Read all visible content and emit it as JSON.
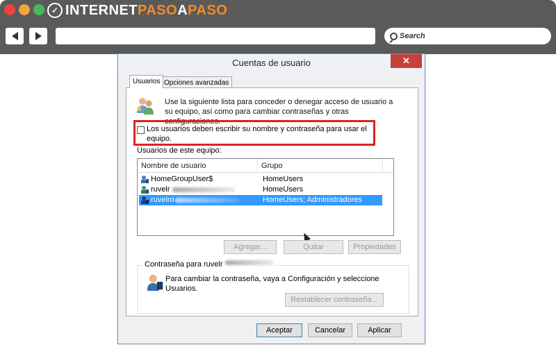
{
  "browser": {
    "logo_part1": "INTERNET",
    "logo_part2": "PASO",
    "logo_part3": "A",
    "logo_part4": "PASO",
    "search_label": "Search",
    "colors": {
      "chrome": "#5a5a5a",
      "logo_accent": "#f28c28"
    }
  },
  "dialog": {
    "title": "Cuentas de usuario",
    "tabs": [
      {
        "label": "Usuarios",
        "active": true
      },
      {
        "label": "Opciones avanzadas",
        "active": false
      }
    ],
    "intro": "Use la siguiente lista para conceder o denegar acceso de usuario a su equipo, así como para cambiar contraseñas y otras configuraciones.",
    "checkbox": {
      "label": "Los usuarios deben escribir su nombre y contraseña para usar el equipo.",
      "checked": false
    },
    "users_group_label": "Usuarios de este equipo:",
    "table": {
      "columns": [
        "Nombre de usuario",
        "Grupo"
      ],
      "rows": [
        {
          "name": "HomeGroupUser$",
          "group": "HomeUsers",
          "selected": false
        },
        {
          "name": "ruvelr",
          "group": "HomeUsers",
          "selected": false
        },
        {
          "name": "ruvelro",
          "group": "HomeUsers; Administradores",
          "selected": true
        }
      ]
    },
    "buttons": {
      "add": "Agregar...",
      "remove": "Quitar",
      "properties": "Propiedades",
      "reset_password": "Restablecer contraseña...",
      "ok": "Aceptar",
      "cancel": "Cancelar",
      "apply": "Aplicar"
    },
    "password_group": {
      "legend": "Contraseña para ruvelr",
      "text": "Para cambiar la contraseña, vaya a Configuración y seleccione Usuarios."
    },
    "colors": {
      "selection": "#3399ff",
      "highlight_box": "#e02020",
      "close": "#c7413a"
    }
  }
}
